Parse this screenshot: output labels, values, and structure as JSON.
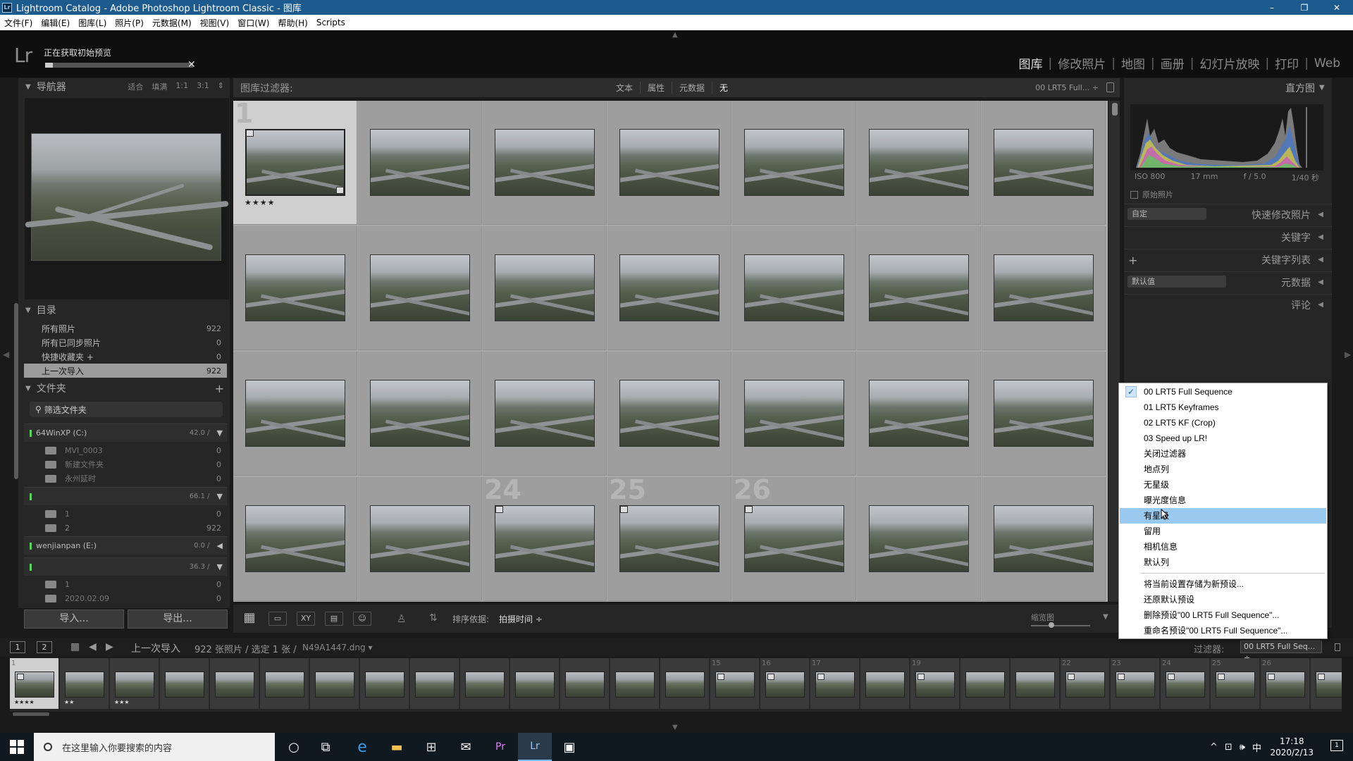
{
  "window": {
    "app_icon": "Lr",
    "title": "Lightroom Catalog - Adobe Photoshop Lightroom Classic - 图库",
    "controls": [
      "–",
      "❐",
      "✕"
    ]
  },
  "menubar": [
    "文件(F)",
    "编辑(E)",
    "图库(L)",
    "照片(P)",
    "元数据(M)",
    "视图(V)",
    "窗口(W)",
    "帮助(H)",
    "Scripts"
  ],
  "identity": {
    "logo": "Lr",
    "progress_label": "正在获取初始预览",
    "progress": 0.05,
    "close": "✕"
  },
  "modules": [
    {
      "label": "图库",
      "active": true
    },
    {
      "label": "修改照片",
      "active": false
    },
    {
      "label": "地图",
      "active": false
    },
    {
      "label": "画册",
      "active": false
    },
    {
      "label": "幻灯片放映",
      "active": false
    },
    {
      "label": "打印",
      "active": false
    },
    {
      "label": "Web",
      "active": false
    }
  ],
  "navigator": {
    "title": "导航器",
    "zoom_options": [
      "适合",
      "填满",
      "1:1",
      "3:1"
    ]
  },
  "catalog": {
    "title": "目录",
    "items": [
      {
        "label": "所有照片",
        "count": "922",
        "selected": false
      },
      {
        "label": "所有已同步照片",
        "count": "0",
        "selected": false
      },
      {
        "label": "快捷收藏夹 +",
        "count": "0",
        "selected": false
      },
      {
        "label": "上一次导入",
        "count": "922",
        "selected": true
      }
    ]
  },
  "folders": {
    "title": "文件夹",
    "add": "+",
    "filter_placeholder": "筛选文件夹",
    "volumes": [
      {
        "name": "64WinXP (C:)",
        "space": "42.0 /",
        "expanded": true,
        "folders": [
          {
            "name": "MVI_0003",
            "count": "0"
          },
          {
            "name": "新建文件夹",
            "count": "0"
          },
          {
            "name": "永州延时",
            "count": "0"
          }
        ]
      },
      {
        "name": "",
        "space": "66.1 /",
        "expanded": true,
        "folders": [
          {
            "name": "1",
            "count": "0"
          },
          {
            "name": "2",
            "count": "922"
          }
        ]
      },
      {
        "name": "wenjianpan (E:)",
        "space": "0.0 /",
        "expanded": false,
        "folders": []
      },
      {
        "name": "",
        "space": "36.3 /",
        "expanded": true,
        "folders": [
          {
            "name": "1",
            "count": "0"
          },
          {
            "name": "2020.02.09",
            "count": "0"
          }
        ]
      }
    ]
  },
  "left_buttons": {
    "import": "导入...",
    "export": "导出..."
  },
  "library_filter": {
    "label": "图库过滤器:",
    "options": [
      {
        "label": "文本",
        "on": false
      },
      {
        "label": "属性",
        "on": false
      },
      {
        "label": "元数据",
        "on": false
      },
      {
        "label": "无",
        "on": true
      }
    ],
    "preset": "00 LRT5 Full... ÷"
  },
  "grid": {
    "rows": [
      [
        {
          "num": "1",
          "selected": true,
          "stars": "★★★★",
          "badge": true
        },
        {
          "num": "",
          "selected": false,
          "stars": "",
          "badge": false
        },
        {
          "num": "",
          "selected": false,
          "stars": "",
          "badge": false
        },
        {
          "num": "",
          "selected": false,
          "stars": "",
          "badge": false
        },
        {
          "num": "",
          "selected": false,
          "stars": "",
          "badge": false
        },
        {
          "num": "",
          "selected": false,
          "stars": "",
          "badge": false
        },
        {
          "num": "",
          "selected": false,
          "stars": "",
          "badge": false
        }
      ],
      [
        {
          "num": "",
          "selected": false,
          "stars": "",
          "badge": false
        },
        {
          "num": "",
          "selected": false,
          "stars": "",
          "badge": false
        },
        {
          "num": "",
          "selected": false,
          "stars": "",
          "badge": false
        },
        {
          "num": "",
          "selected": false,
          "stars": "",
          "badge": false
        },
        {
          "num": "",
          "selected": false,
          "stars": "",
          "badge": false
        },
        {
          "num": "",
          "selected": false,
          "stars": "",
          "badge": false
        },
        {
          "num": "",
          "selected": false,
          "stars": "",
          "badge": false
        }
      ],
      [
        {
          "num": "",
          "selected": false,
          "stars": "",
          "badge": false
        },
        {
          "num": "",
          "selected": false,
          "stars": "",
          "badge": false
        },
        {
          "num": "",
          "selected": false,
          "stars": "",
          "badge": false
        },
        {
          "num": "",
          "selected": false,
          "stars": "",
          "badge": false
        },
        {
          "num": "",
          "selected": false,
          "stars": "",
          "badge": false
        },
        {
          "num": "",
          "selected": false,
          "stars": "",
          "badge": false
        },
        {
          "num": "",
          "selected": false,
          "stars": "",
          "badge": false
        }
      ],
      [
        {
          "num": "",
          "selected": false,
          "stars": "",
          "badge": false
        },
        {
          "num": "",
          "selected": false,
          "stars": "",
          "badge": false
        },
        {
          "num": "24",
          "selected": false,
          "stars": "",
          "badge": true
        },
        {
          "num": "25",
          "selected": false,
          "stars": "",
          "badge": true
        },
        {
          "num": "26",
          "selected": false,
          "stars": "",
          "badge": true
        },
        {
          "num": "",
          "selected": false,
          "stars": "",
          "badge": false
        },
        {
          "num": "",
          "selected": false,
          "stars": "",
          "badge": false
        }
      ]
    ]
  },
  "toolbar": {
    "view_icons": [
      "grid-view-icon",
      "loupe-view-icon",
      "compare-view-icon",
      "survey-view-icon",
      "people-view-icon"
    ],
    "view_glyphs": [
      "▦",
      "▭",
      "XY",
      "▤",
      "☺"
    ],
    "spray": "♙",
    "sort_icon": "⇅",
    "sort_label": "排序依据:",
    "sort_value": "拍摄时间 ÷",
    "thumbs_label": "缩览图",
    "thumb_size": 0.35,
    "menu_arrow": "▼"
  },
  "histogram": {
    "title": "直方图",
    "iso": "ISO 800",
    "focal": "17 mm",
    "aperture": "f / 5.0",
    "shutter": "1/40 秒",
    "original": "原始照片"
  },
  "right_sections": [
    {
      "label": "快速修改照片",
      "select": "自定"
    },
    {
      "label": "关键字",
      "select": ""
    },
    {
      "label": "关键字列表",
      "select": ""
    },
    {
      "label": "元数据",
      "select": "默认值"
    },
    {
      "label": "评论",
      "select": ""
    }
  ],
  "context_menu": {
    "items": [
      {
        "label": "00 LRT5 Full Sequence",
        "checked": true,
        "highlighted": false
      },
      {
        "label": "01 LRT5 Keyframes",
        "checked": false,
        "highlighted": false
      },
      {
        "label": "02 LRT5 KF (Crop)",
        "checked": false,
        "highlighted": false
      },
      {
        "label": "03 Speed up LR!",
        "checked": false,
        "highlighted": false
      },
      {
        "label": "关闭过滤器",
        "checked": false,
        "highlighted": false
      },
      {
        "label": "地点列",
        "checked": false,
        "highlighted": false
      },
      {
        "label": "无星级",
        "checked": false,
        "highlighted": false
      },
      {
        "label": "曝光度信息",
        "checked": false,
        "highlighted": false
      },
      {
        "label": "有星级",
        "checked": false,
        "highlighted": true
      },
      {
        "label": "留用",
        "checked": false,
        "highlighted": false
      },
      {
        "label": "相机信息",
        "checked": false,
        "highlighted": false
      },
      {
        "label": "默认列",
        "checked": false,
        "highlighted": false
      }
    ],
    "actions": [
      "将当前设置存储为新预设...",
      "还原默认预设",
      "删除预设\"00 LRT5 Full Sequence\"...",
      "重命名预设\"00 LRT5 Full Sequence\"..."
    ]
  },
  "filmstrip_header": {
    "screen1": "1",
    "screen2": "2",
    "source": "上一次导入",
    "count": "922 张照片 / 选定 1 张 /",
    "filename": "N49A1447.dng ▾",
    "filter_label": "过滤器:",
    "filter_value": "00 LRT5 Full Seq... ÷"
  },
  "filmstrip": [
    {
      "num": "1",
      "selected": true,
      "stars": "★★★★",
      "badge": true
    },
    {
      "num": "",
      "selected": false,
      "stars": "★★",
      "badge": false
    },
    {
      "num": "",
      "selected": false,
      "stars": "★★★",
      "badge": false
    },
    {
      "num": "",
      "selected": false,
      "stars": "",
      "badge": false
    },
    {
      "num": "",
      "selected": false,
      "stars": "",
      "badge": false
    },
    {
      "num": "",
      "selected": false,
      "stars": "",
      "badge": false
    },
    {
      "num": "",
      "selected": false,
      "stars": "",
      "badge": false
    },
    {
      "num": "",
      "selected": false,
      "stars": "",
      "badge": false
    },
    {
      "num": "",
      "selected": false,
      "stars": "",
      "badge": false
    },
    {
      "num": "",
      "selected": false,
      "stars": "",
      "badge": false
    },
    {
      "num": "",
      "selected": false,
      "stars": "",
      "badge": false
    },
    {
      "num": "",
      "selected": false,
      "stars": "",
      "badge": false
    },
    {
      "num": "",
      "selected": false,
      "stars": "",
      "badge": false
    },
    {
      "num": "",
      "selected": false,
      "stars": "",
      "badge": false
    },
    {
      "num": "15",
      "selected": false,
      "stars": "",
      "badge": true
    },
    {
      "num": "16",
      "selected": false,
      "stars": "",
      "badge": true
    },
    {
      "num": "17",
      "selected": false,
      "stars": "",
      "badge": true
    },
    {
      "num": "",
      "selected": false,
      "stars": "",
      "badge": false
    },
    {
      "num": "19",
      "selected": false,
      "stars": "",
      "badge": true
    },
    {
      "num": "",
      "selected": false,
      "stars": "",
      "badge": false
    },
    {
      "num": "",
      "selected": false,
      "stars": "",
      "badge": false
    },
    {
      "num": "22",
      "selected": false,
      "stars": "",
      "badge": true
    },
    {
      "num": "23",
      "selected": false,
      "stars": "",
      "badge": true
    },
    {
      "num": "24",
      "selected": false,
      "stars": "",
      "badge": true
    },
    {
      "num": "25",
      "selected": false,
      "stars": "",
      "badge": true
    },
    {
      "num": "26",
      "selected": false,
      "stars": "",
      "badge": true
    },
    {
      "num": "",
      "selected": false,
      "stars": "",
      "badge": true
    }
  ],
  "taskbar": {
    "search_placeholder": "在这里输入你要搜索的内容",
    "apps": [
      {
        "name": "cortana-icon",
        "glyph": "○",
        "active": false
      },
      {
        "name": "task-view-icon",
        "glyph": "⧉",
        "active": false
      },
      {
        "name": "edge-icon",
        "glyph": "e",
        "active": false
      },
      {
        "name": "file-explorer-icon",
        "glyph": "▬",
        "active": false
      },
      {
        "name": "store-icon",
        "glyph": "⊞",
        "active": false
      },
      {
        "name": "mail-icon",
        "glyph": "✉",
        "active": false
      },
      {
        "name": "premiere-icon",
        "glyph": "Pr",
        "active": false
      },
      {
        "name": "lightroom-icon",
        "glyph": "Lr",
        "active": true
      },
      {
        "name": "app-icon",
        "glyph": "▣",
        "active": false
      }
    ],
    "tray": [
      "^",
      "⊡",
      "🕪",
      "中"
    ],
    "time": "17:18",
    "date": "2020/2/13",
    "notifications": "1"
  },
  "colors": {
    "titlebar": "#1d5b8f",
    "menu_highlight": "#99c9ef",
    "selected_row": "#9b9b9b",
    "grid_bg": "#a9a9a9"
  }
}
